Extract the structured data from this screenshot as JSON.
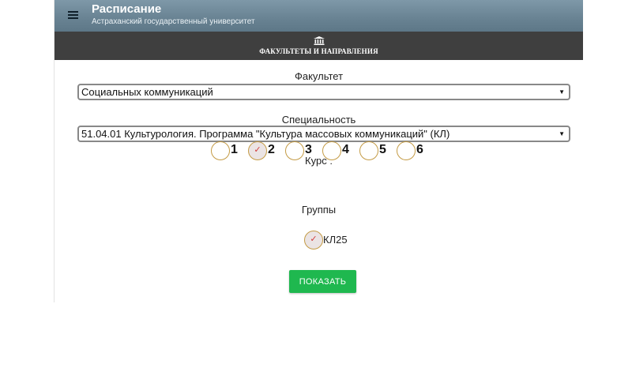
{
  "app": {
    "title": "Расписание",
    "subtitle": "Астраханский государственный университет"
  },
  "section": {
    "label": "ФАКУЛЬТЕТЫ И НАПРАВЛЕНИЯ",
    "icon": "building-columns-icon"
  },
  "faculty": {
    "label": "Факультет",
    "selected": "Социальных коммуникаций"
  },
  "specialty": {
    "label": "Специальность",
    "selected": "51.04.01 Культурология. Программа \"Культура массовых коммуникаций\" (КЛ)"
  },
  "course": {
    "label": "Курс :",
    "options": [
      "1",
      "2",
      "3",
      "4",
      "5",
      "6"
    ],
    "selected": "2"
  },
  "groups": {
    "label": "Группы",
    "items": [
      {
        "name": "КЛ25",
        "checked": true
      }
    ]
  },
  "actions": {
    "show_label": "ПОКАЗАТЬ"
  },
  "colors": {
    "appbar": "#6a8494",
    "section_bar": "#3f3f3f",
    "radio_border": "#c49b45",
    "check_mark": "#d23b3b",
    "button": "#1fb84f"
  }
}
